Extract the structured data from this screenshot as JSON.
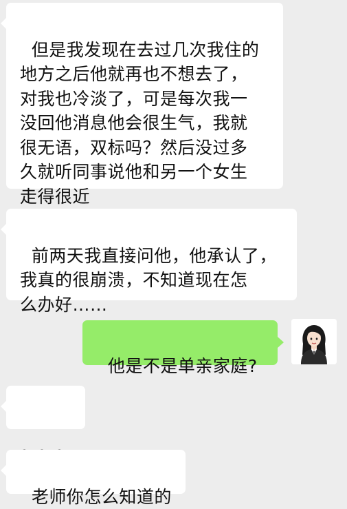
{
  "conversation": {
    "messages": [
      {
        "sender": "contact",
        "text": "但是我发现在去过几次我住的\n地方之后他就再也不想去了，\n对我也冷淡了，可是每次我一\n没回他消息他会很生气，我就\n很无语，双标吗？然后没过多\n久就听同事说他和另一个女生\n走得很近"
      },
      {
        "sender": "contact",
        "text": "前两天我直接问他，他承认了，\n我真的很崩溃，不知道现在怎\n么办好……"
      },
      {
        "sender": "self",
        "text": "他是不是单亲家庭?"
      },
      {
        "sender": "contact",
        "text": "？？？"
      },
      {
        "sender": "contact",
        "text": "老师你怎么知道的"
      }
    ]
  },
  "colors": {
    "background": "#ededed",
    "incoming_bubble": "#ffffff",
    "outgoing_bubble": "#95ec69",
    "text": "#111111"
  },
  "icons": {
    "self_avatar": "avatar-woman-in-suit-icon"
  }
}
